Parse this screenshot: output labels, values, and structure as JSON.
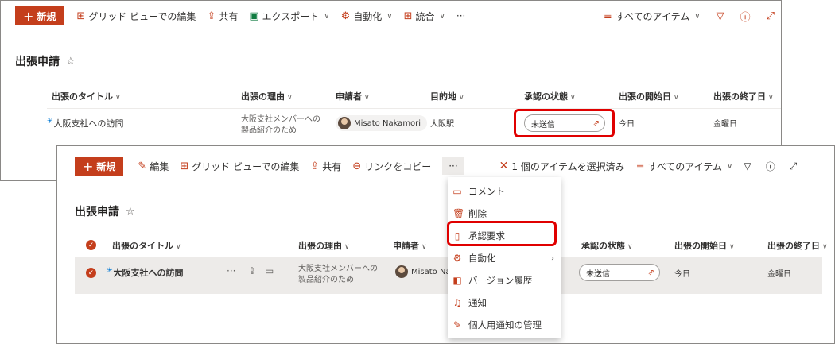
{
  "back": {
    "toolbar": {
      "new_label": "新規",
      "grid_edit_label": "グリッド ビューでの編集",
      "share_label": "共有",
      "export_label": "エクスポート",
      "automate_label": "自動化",
      "integrate_label": "統合",
      "more_label": "···",
      "view_label": "すべてのアイテム"
    },
    "list_title": "出張申請",
    "columns": {
      "title": "出張のタイトル",
      "reason": "出張の理由",
      "requester": "申請者",
      "destination": "目的地",
      "approval": "承認の状態",
      "start": "出張の開始日",
      "end": "出張の終了日"
    },
    "row": {
      "title": "大阪支社への訪問",
      "reason": "大阪支社メンバーへの 製品紹介のため",
      "requester": "Misato Nakamori",
      "destination": "大阪駅",
      "approval": "未送信",
      "start": "今日",
      "end": "金曜日"
    }
  },
  "front": {
    "toolbar": {
      "new_label": "新規",
      "edit_label": "編集",
      "grid_edit_label": "グリッド ビューでの編集",
      "share_label": "共有",
      "copy_link_label": "リンクをコピー",
      "more_label": "···",
      "selected_label": "1 個のアイテムを選択済み",
      "view_label": "すべてのアイテム"
    },
    "list_title": "出張申請",
    "columns": {
      "title": "出張のタイトル",
      "reason": "出張の理由",
      "requester": "申請者",
      "approval": "承認の状態",
      "start": "出張の開始日",
      "end": "出張の終了日"
    },
    "row": {
      "title": "大阪支社への訪問",
      "reason": "大阪支社メンバーへの 製品紹介のため",
      "requester": "Misato Nak",
      "approval": "未送信",
      "start": "今日",
      "end": "金曜日"
    },
    "menu": [
      {
        "label": "コメント",
        "icon": "comment-icon"
      },
      {
        "label": "削除",
        "icon": "trash-icon"
      },
      {
        "label": "承認要求",
        "icon": "document-icon"
      },
      {
        "label": "自動化",
        "icon": "automate-icon"
      },
      {
        "label": "バージョン履歴",
        "icon": "history-icon"
      },
      {
        "label": "通知",
        "icon": "bell-icon"
      },
      {
        "label": "個人用通知の管理",
        "icon": "manage-alerts-icon"
      }
    ]
  },
  "colors": {
    "accent": "#c43e1c",
    "highlight": "#e00000",
    "selected_row": "#edebe9"
  }
}
